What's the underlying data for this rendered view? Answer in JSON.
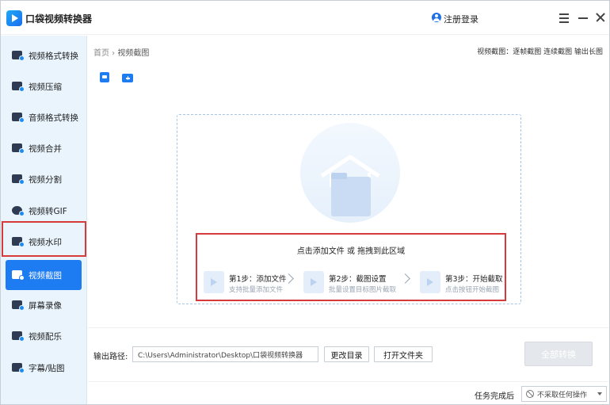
{
  "app": {
    "title": "口袋视频转换器",
    "login": "注册登录"
  },
  "sidebar": {
    "items": [
      {
        "label": "视频格式转换",
        "icon": "video-convert-icon"
      },
      {
        "label": "视频压缩",
        "icon": "video-compress-icon"
      },
      {
        "label": "音频格式转换",
        "icon": "audio-convert-icon"
      },
      {
        "label": "视频合并",
        "icon": "video-merge-icon"
      },
      {
        "label": "视频分割",
        "icon": "video-split-icon"
      },
      {
        "label": "视频转GIF",
        "icon": "gif-icon"
      },
      {
        "label": "视频水印",
        "icon": "watermark-icon"
      },
      {
        "label": "视频截图",
        "icon": "screenshot-icon",
        "active": true
      },
      {
        "label": "屏幕录像",
        "icon": "screen-record-icon"
      },
      {
        "label": "视频配乐",
        "icon": "music-icon"
      },
      {
        "label": "字幕/贴图",
        "icon": "subtitle-icon"
      }
    ]
  },
  "breadcrumb": {
    "home": "首页",
    "current": "视频截图"
  },
  "crumb_links": "视频截图：逐帧截图 连续截图 输出长图",
  "dropzone": {
    "text": "点击添加文件 或 拖拽到此区域",
    "steps": [
      {
        "title": "第1步：添加文件",
        "sub": "支持批量添加文件"
      },
      {
        "title": "第2步：截图设置",
        "sub": "批量设置目标图片截取"
      },
      {
        "title": "第3步：开始截取",
        "sub": "点击按钮开始截图"
      }
    ]
  },
  "output": {
    "label": "输出路径:",
    "path": "C:\\Users\\Administrator\\Desktop\\口袋视频转换器",
    "change_btn": "更改目录",
    "open_btn": "打开文件夹",
    "convert_btn": "全部转换"
  },
  "after": {
    "label": "任务完成后",
    "value": "不采取任何操作"
  },
  "colors": {
    "accent": "#1e7cf2",
    "highlight": "#d73a3a",
    "sidebar_bg": "#e9f4fd"
  }
}
